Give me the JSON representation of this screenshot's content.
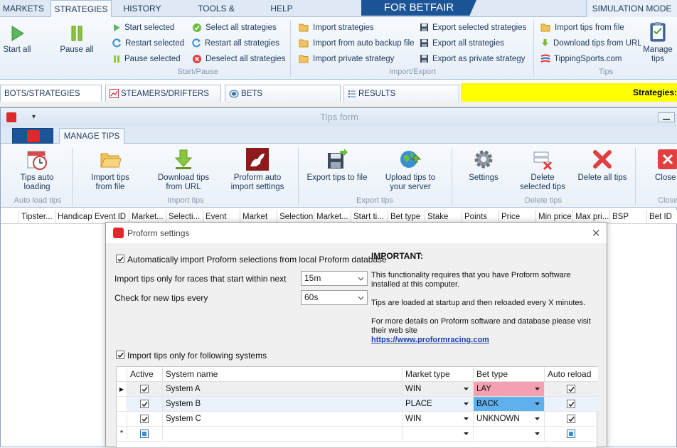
{
  "top_tabs": [
    "MARKETS",
    "STRATEGIES",
    "HISTORY",
    "TOOLS & SETTINGS",
    "HELP"
  ],
  "brand": "FOR BETFAIR",
  "mode": "SIMULATION MODE",
  "ribbon": {
    "start_all": "Start all",
    "pause_all": "Pause all",
    "start_selected": "Start selected",
    "restart_selected": "Restart selected",
    "pause_selected": "Pause selected",
    "select_all": "Select all strategies",
    "restart_all": "Restart all strategies",
    "deselect_all": "Deselect all strategies",
    "group_start_pause": "Start/Pause",
    "import_strategies": "Import strategies",
    "import_backup": "Import from auto backup file",
    "import_private": "Import private strategy",
    "export_selected": "Export selected strategies",
    "export_all": "Export all strategies",
    "export_private": "Export as private strategy",
    "group_import_export": "Import/Export",
    "import_tips_file": "Import tips from file",
    "download_tips_url": "Download tips from URL",
    "tippingsports": "TippingSports.com",
    "manage_tips": "Manage tips",
    "group_tips": "Tips"
  },
  "doc_tabs": [
    "BOTS/STRATEGIES",
    "STEAMERS/DRIFTERS",
    "BETS",
    "RESULTS"
  ],
  "strategies_label": "Strategies:",
  "tips_form": {
    "title": "Tips form",
    "tab": "MANAGE TIPS",
    "tips_auto_loading": "Tips auto loading",
    "group_auto_load": "Auto load tips",
    "import_tips": "Import tips from file",
    "download_tips": "Download tips from URL",
    "proform_auto": "Proform auto import settings",
    "group_import": "Import tips",
    "export_tips": "Export tips to file",
    "upload_tips": "Upload tips to your server",
    "group_export": "Export tips",
    "settings": "Settings",
    "delete_selected": "Delete selected tips",
    "delete_all": "Delete all tips",
    "group_delete": "Delete tips",
    "close": "Close",
    "group_close": "Close",
    "columns": [
      "Tipster...",
      "Handicap",
      "Event ID",
      "Market...",
      "Selecti...",
      "Event",
      "Market",
      "Selection",
      "Market...",
      "Start ti...",
      "Bet type",
      "Stake",
      "Points",
      "Price",
      "Min price",
      "Max pri...",
      "BSP",
      "Bet ID"
    ]
  },
  "dialog": {
    "title": "Proform settings",
    "auto_import_label": "Automatically import Proform selections from local Proform database",
    "auto_import_checked": true,
    "races_label": "Import tips only for races that start within next",
    "races_value": "15m",
    "check_label": "Check for new tips every",
    "check_value": "60s",
    "important_title": "IMPORTANT:",
    "important_1": "This functionality requires that you have Proform software installed at this computer.",
    "important_2": "Tips are loaded at startup and then reloaded every X minutes.",
    "important_3": "For more details on Proform software and database please visit their web site",
    "link": "https://www.proformracing.com",
    "systems_label": "Import tips only for following systems",
    "systems_checked": true,
    "grid_headers": [
      "Active",
      "System name",
      "Market type",
      "Bet type",
      "Auto reload"
    ],
    "rows": [
      {
        "active": true,
        "name": "System A",
        "market": "WIN",
        "bet": "LAY",
        "bet_color": "#f4a0b0",
        "reload": true
      },
      {
        "active": true,
        "name": "System B",
        "market": "PLACE",
        "bet": "BACK",
        "bet_color": "#5fb0ec",
        "reload": true
      },
      {
        "active": true,
        "name": "System C",
        "market": "WIN",
        "bet": "UNKNOWN",
        "bet_color": "#ffffff",
        "reload": true
      }
    ],
    "new_row_marker": "*"
  }
}
